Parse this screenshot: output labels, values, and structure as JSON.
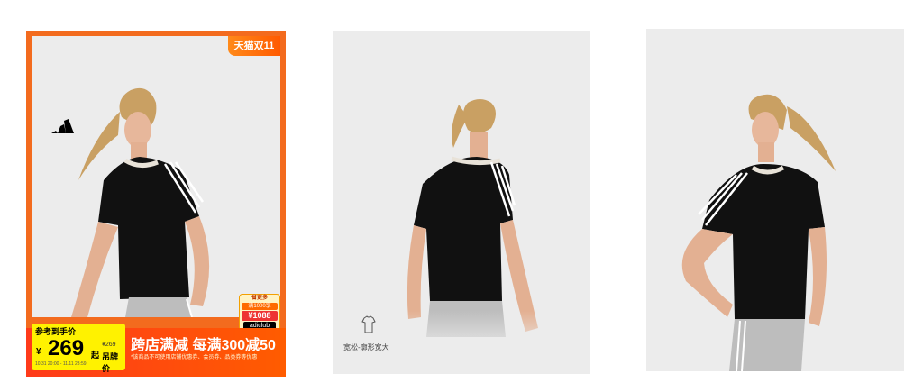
{
  "cards": [
    {
      "tag": "天猫双11",
      "badge": {
        "line1": "省更多",
        "line2": "满1000享",
        "price": "¥1088",
        "brand": "adiclub"
      },
      "price_box": {
        "label": "参考到手价",
        "currency": "¥",
        "price": "269",
        "suffix": "起",
        "original": "¥269",
        "original_label": "吊牌价",
        "time_range": "10.31 20:00 - 11.11 23:59"
      },
      "promo_title": "跨店满减 每满300减50",
      "promo_note": "*该商品不可使用店铺优惠券、会员券、品类券等优惠"
    },
    {
      "fit_label": "宽松-廓形宽大"
    },
    {}
  ],
  "colors": {
    "accent": "#f36b1e",
    "price_yellow": "#fff200",
    "shirt": "#111111"
  }
}
